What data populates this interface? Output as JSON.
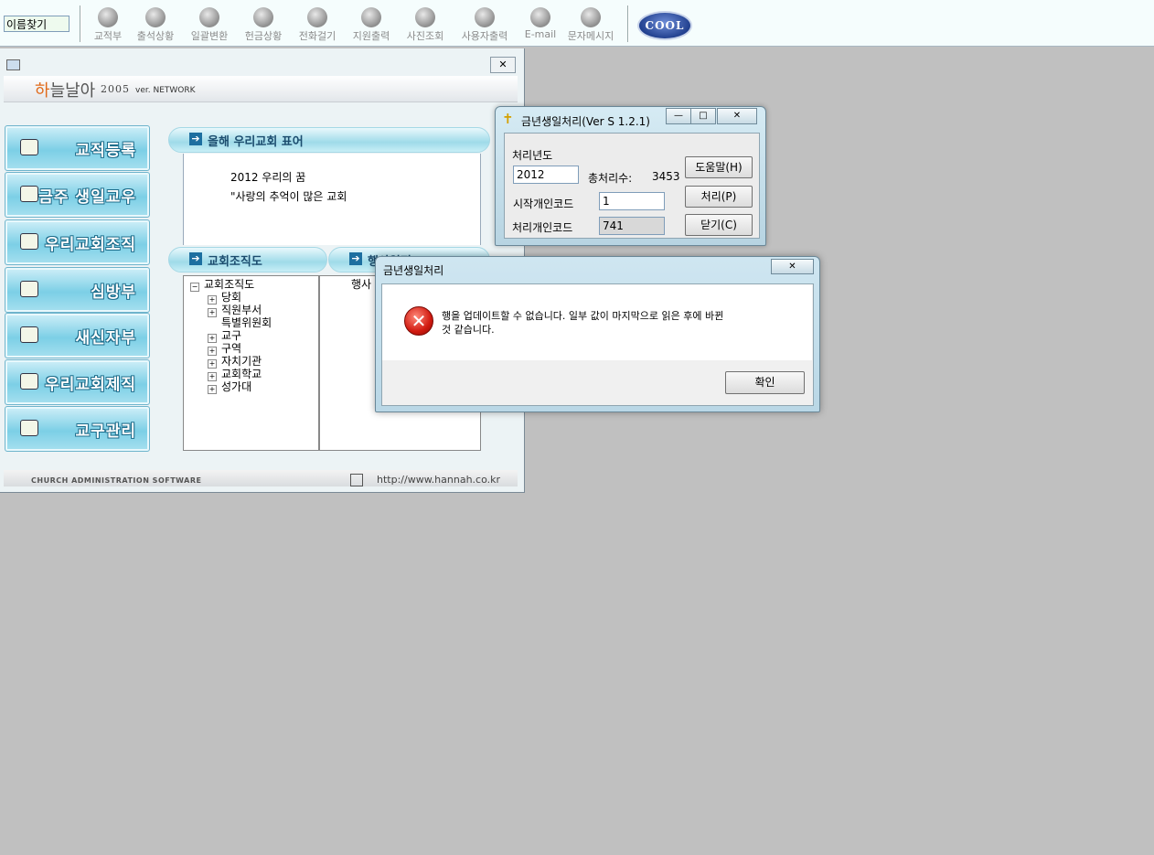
{
  "toolbar": {
    "search_value": "이름찾기",
    "buttons": [
      "교적부",
      "출석상황",
      "일괄변환",
      "헌금상황",
      "전화걸기",
      "지원출력",
      "사진조회",
      "사용자출력",
      "E-mail",
      "문자메시지"
    ],
    "logo": "COOL"
  },
  "main_window": {
    "close": "✕",
    "logo": {
      "part1": "하",
      "part2": "늘날아",
      "year": "2005",
      "version": "ver. NETWORK"
    },
    "sidebar": [
      "교적등록",
      "금주 생일교우",
      "우리교회조직",
      "심방부",
      "새신자부",
      "우리교회제직",
      "교구관리"
    ],
    "motto_section": {
      "title": "올해 우리교회 표어",
      "line1": "2012 우리의 꿈",
      "line2": "\"사랑의 추억이 많은 교회"
    },
    "org_section": {
      "title": "교회조직도",
      "tree": [
        {
          "label": "교회조직도",
          "level": 0,
          "box": "−"
        },
        {
          "label": "당회",
          "level": 1,
          "box": "+"
        },
        {
          "label": "직원부서",
          "level": 1,
          "box": "+"
        },
        {
          "label": "특별위원회",
          "level": 1,
          "box": ""
        },
        {
          "label": "교구",
          "level": 1,
          "box": "+"
        },
        {
          "label": "구역",
          "level": 1,
          "box": "+"
        },
        {
          "label": "자치기관",
          "level": 1,
          "box": "+"
        },
        {
          "label": "교회학교",
          "level": 1,
          "box": "+"
        },
        {
          "label": "성가대",
          "level": 1,
          "box": "+"
        }
      ]
    },
    "events_section": {
      "title": "행사일정",
      "item": "행사"
    },
    "status": {
      "left": "CHURCH ADMINISTRATION SOFTWARE",
      "url": "http://www.hannah.co.kr"
    }
  },
  "birthday_dialog": {
    "title": "금년생일처리(Ver S 1.2.1)",
    "minimize": "—",
    "maximize": "□",
    "close": "✕",
    "year_label": "처리년도",
    "year_value": "2012",
    "total_label": "총처리수:",
    "total_value": "3453",
    "start_label": "시작개인코드",
    "start_value": "1",
    "proc_label": "처리개인코드",
    "proc_value": "741",
    "help_btn": "도움말(H)",
    "process_btn": "처리(P)",
    "close_btn": "닫기(C)"
  },
  "error_dialog": {
    "title": "금년생일처리",
    "close": "✕",
    "icon": "✕",
    "message_line1": "행을 업데이트할 수 없습니다. 일부 값이 마지막으로 읽은 후에 바뀐",
    "message_line2": "것 같습니다.",
    "ok": "확인"
  }
}
